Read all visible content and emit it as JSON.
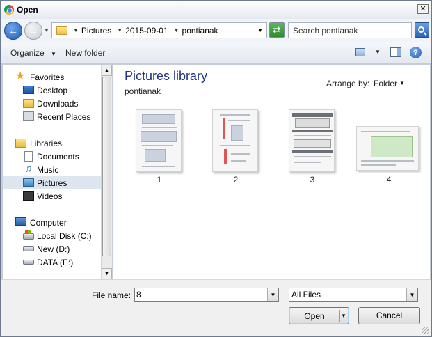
{
  "window": {
    "title": "Open"
  },
  "titlebar": {
    "close_glyph": "✕"
  },
  "address": {
    "breadcrumbs": [
      "Pictures",
      "2015-09-01",
      "pontianak"
    ],
    "search_placeholder": "Search pontianak"
  },
  "toolbar": {
    "organize_label": "Organize",
    "new_folder_label": "New folder",
    "help_glyph": "?"
  },
  "nav": {
    "favorites": {
      "label": "Favorites",
      "items": [
        {
          "label": "Desktop",
          "icon": "desktop-icon"
        },
        {
          "label": "Downloads",
          "icon": "downloads-icon"
        },
        {
          "label": "Recent Places",
          "icon": "recent-places-icon"
        }
      ]
    },
    "libraries": {
      "label": "Libraries",
      "items": [
        {
          "label": "Documents",
          "icon": "documents-icon"
        },
        {
          "label": "Music",
          "icon": "music-icon"
        },
        {
          "label": "Pictures",
          "icon": "pictures-icon",
          "selected": true
        },
        {
          "label": "Videos",
          "icon": "videos-icon"
        }
      ]
    },
    "computer": {
      "label": "Computer",
      "items": [
        {
          "label": "Local Disk (C:)",
          "icon": "system-drive-icon"
        },
        {
          "label": "New (D:)",
          "icon": "drive-icon"
        },
        {
          "label": "DATA (E:)",
          "icon": "drive-icon"
        }
      ]
    }
  },
  "content": {
    "title": "Pictures library",
    "subtitle": "pontianak",
    "arrange_label": "Arrange by:",
    "arrange_value": "Folder",
    "files": [
      {
        "name": "1"
      },
      {
        "name": "2"
      },
      {
        "name": "3"
      },
      {
        "name": "4"
      }
    ]
  },
  "footer": {
    "file_name_label": "File name:",
    "file_name_value": "8",
    "file_type_value": "All Files",
    "open_label": "Open",
    "cancel_label": "Cancel"
  },
  "colors": {
    "title_blue": "#1e3287",
    "selection": "#dde5ef",
    "frame": "#c6cdd6"
  }
}
